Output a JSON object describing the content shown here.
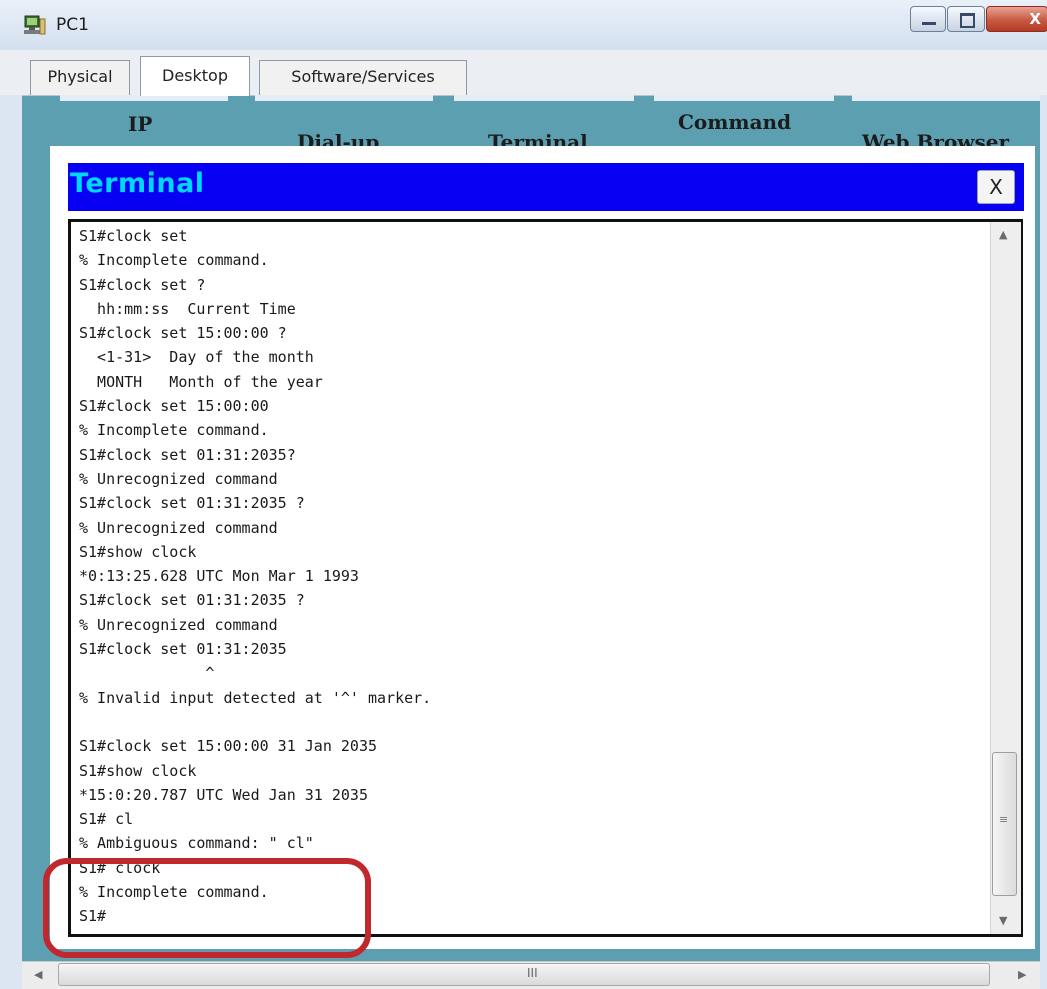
{
  "window": {
    "title": "PC1",
    "icon": "pc-computer-icon",
    "controls": [
      "minimize-icon",
      "maximize-icon",
      "close-icon"
    ],
    "close_glyph": "X"
  },
  "tabs": [
    "Physical",
    "Desktop",
    "Software/Services"
  ],
  "active_tab": "Desktop",
  "desktop_apps": [
    "IP",
    "Dial-up",
    "Terminal",
    "Command",
    "Web Browser"
  ],
  "dialog": {
    "title": "Terminal",
    "close_label": "X",
    "title_bar_color": "#0800f2",
    "title_text_color": "#00d7ff"
  },
  "terminal": {
    "lines": [
      "S1#clock set",
      "% Incomplete command.",
      "S1#clock set ?",
      "  hh:mm:ss  Current Time",
      "S1#clock set 15:00:00 ?",
      "  <1-31>  Day of the month",
      "  MONTH   Month of the year",
      "S1#clock set 15:00:00",
      "% Incomplete command.",
      "S1#clock set 01:31:2035?",
      "% Unrecognized command",
      "S1#clock set 01:31:2035 ?",
      "% Unrecognized command",
      "S1#show clock",
      "*0:13:25.628 UTC Mon Mar 1 1993",
      "S1#clock set 01:31:2035 ?",
      "% Unrecognized command",
      "S1#clock set 01:31:2035",
      "              ^",
      "% Invalid input detected at '^' marker.",
      "",
      "S1#clock set 15:00:00 31 Jan 2035",
      "S1#show clock",
      "*15:0:20.787 UTC Wed Jan 31 2035",
      "S1# cl",
      "% Ambiguous command: \" cl\"",
      "S1# clock",
      "% Incomplete command.",
      "S1#"
    ],
    "scroll_position": 0.92,
    "highlight_color": "#c1282d"
  },
  "hscroll": {
    "grip": "III"
  }
}
